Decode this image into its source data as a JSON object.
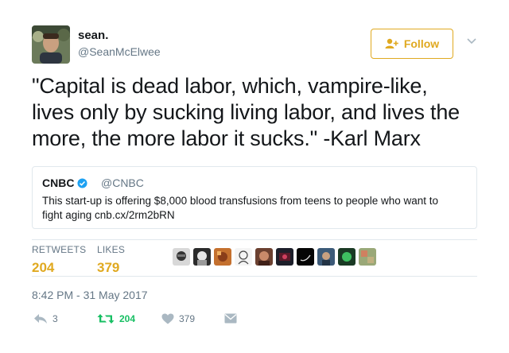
{
  "author": {
    "name": "sean.",
    "handle": "@SeanMcElwee"
  },
  "follow_button": {
    "label": "Follow"
  },
  "tweet": {
    "text_lines": [
      "\"Capital is dead labor, which, vampire-like,",
      "lives only by sucking living labor, and lives the",
      "more, the more labor it sucks.\" -Karl Marx"
    ]
  },
  "quoted_tweet": {
    "name": "CNBC",
    "handle": "@CNBC",
    "text_lines": [
      "This start-up is offering $8,000 blood transfusions from teens to people who want to",
      "fight aging  cnb.cx/2rm2bRN"
    ]
  },
  "stats": {
    "retweets_label": "RETWEETS",
    "retweets_value": "204",
    "likes_label": "LIKES",
    "likes_value": "379"
  },
  "timestamp": "8:42 PM - 31 May 2017",
  "actions": {
    "reply_count": "3",
    "retweet_count": "204",
    "like_count": "379"
  },
  "colors": {
    "accent": "#e0a920",
    "retweet_green": "#17bf63",
    "muted": "#657786",
    "verified_blue": "#1da1f2"
  },
  "icons": [
    "add-user-icon",
    "chevron-down-icon",
    "verified-icon",
    "reply-icon",
    "retweet-icon",
    "heart-icon",
    "message-icon"
  ]
}
